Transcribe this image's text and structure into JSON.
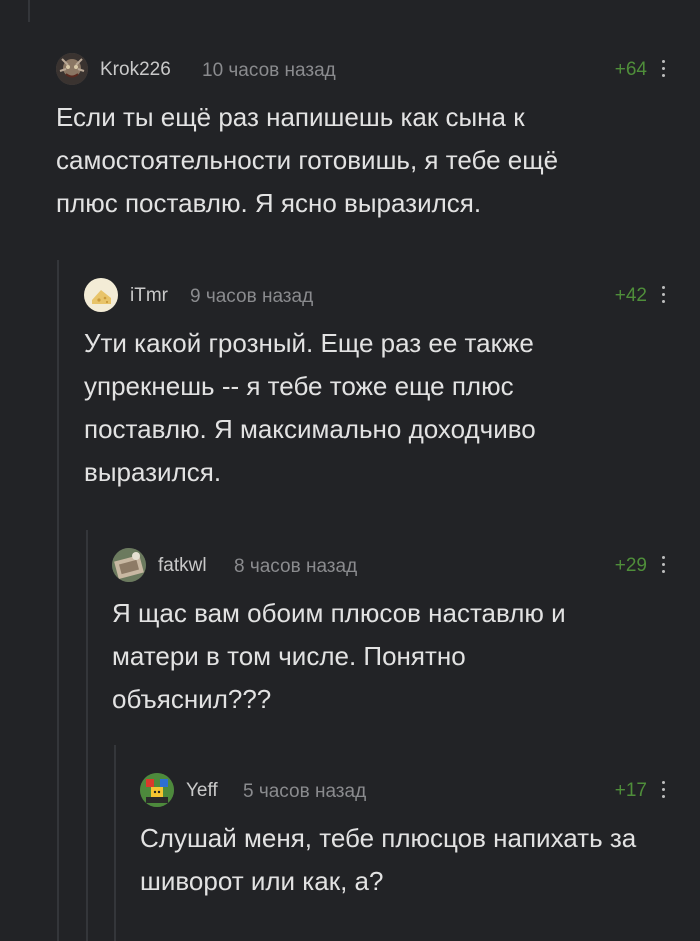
{
  "comments": [
    {
      "username": "Krok226",
      "time": "10 часов назад",
      "rating": "+64",
      "text": "Если ты ещё раз напишешь как сына к самостоятельности готовишь, я тебе ещё плюс поставлю. Я ясно выразился.",
      "avatar_icon": "monster-avatar"
    },
    {
      "username": "iTmr",
      "time": "9 часов назад",
      "rating": "+42",
      "text": "Ути какой грозный. Еще раз ее также упрекнешь -- я тебе тоже еще плюс поставлю. Я максимально доходчиво выразился.",
      "avatar_icon": "cheese-avatar"
    },
    {
      "username": "fatkwl",
      "time": "8 часов назад",
      "rating": "+29",
      "text": "Я щас вам обоим плюсов наставлю и матери в том числе. Понятно объяснил???",
      "avatar_icon": "photo-avatar"
    },
    {
      "username": "Yeff",
      "time": "5 часов назад",
      "rating": "+17",
      "text": "Слушай меня, тебе плюсцов напихать за шиворот или как, а?",
      "avatar_icon": "lego-avatar"
    }
  ],
  "colors": {
    "background": "#222326",
    "rating_positive": "#4f8e3a",
    "thread_line": "#34363a"
  }
}
